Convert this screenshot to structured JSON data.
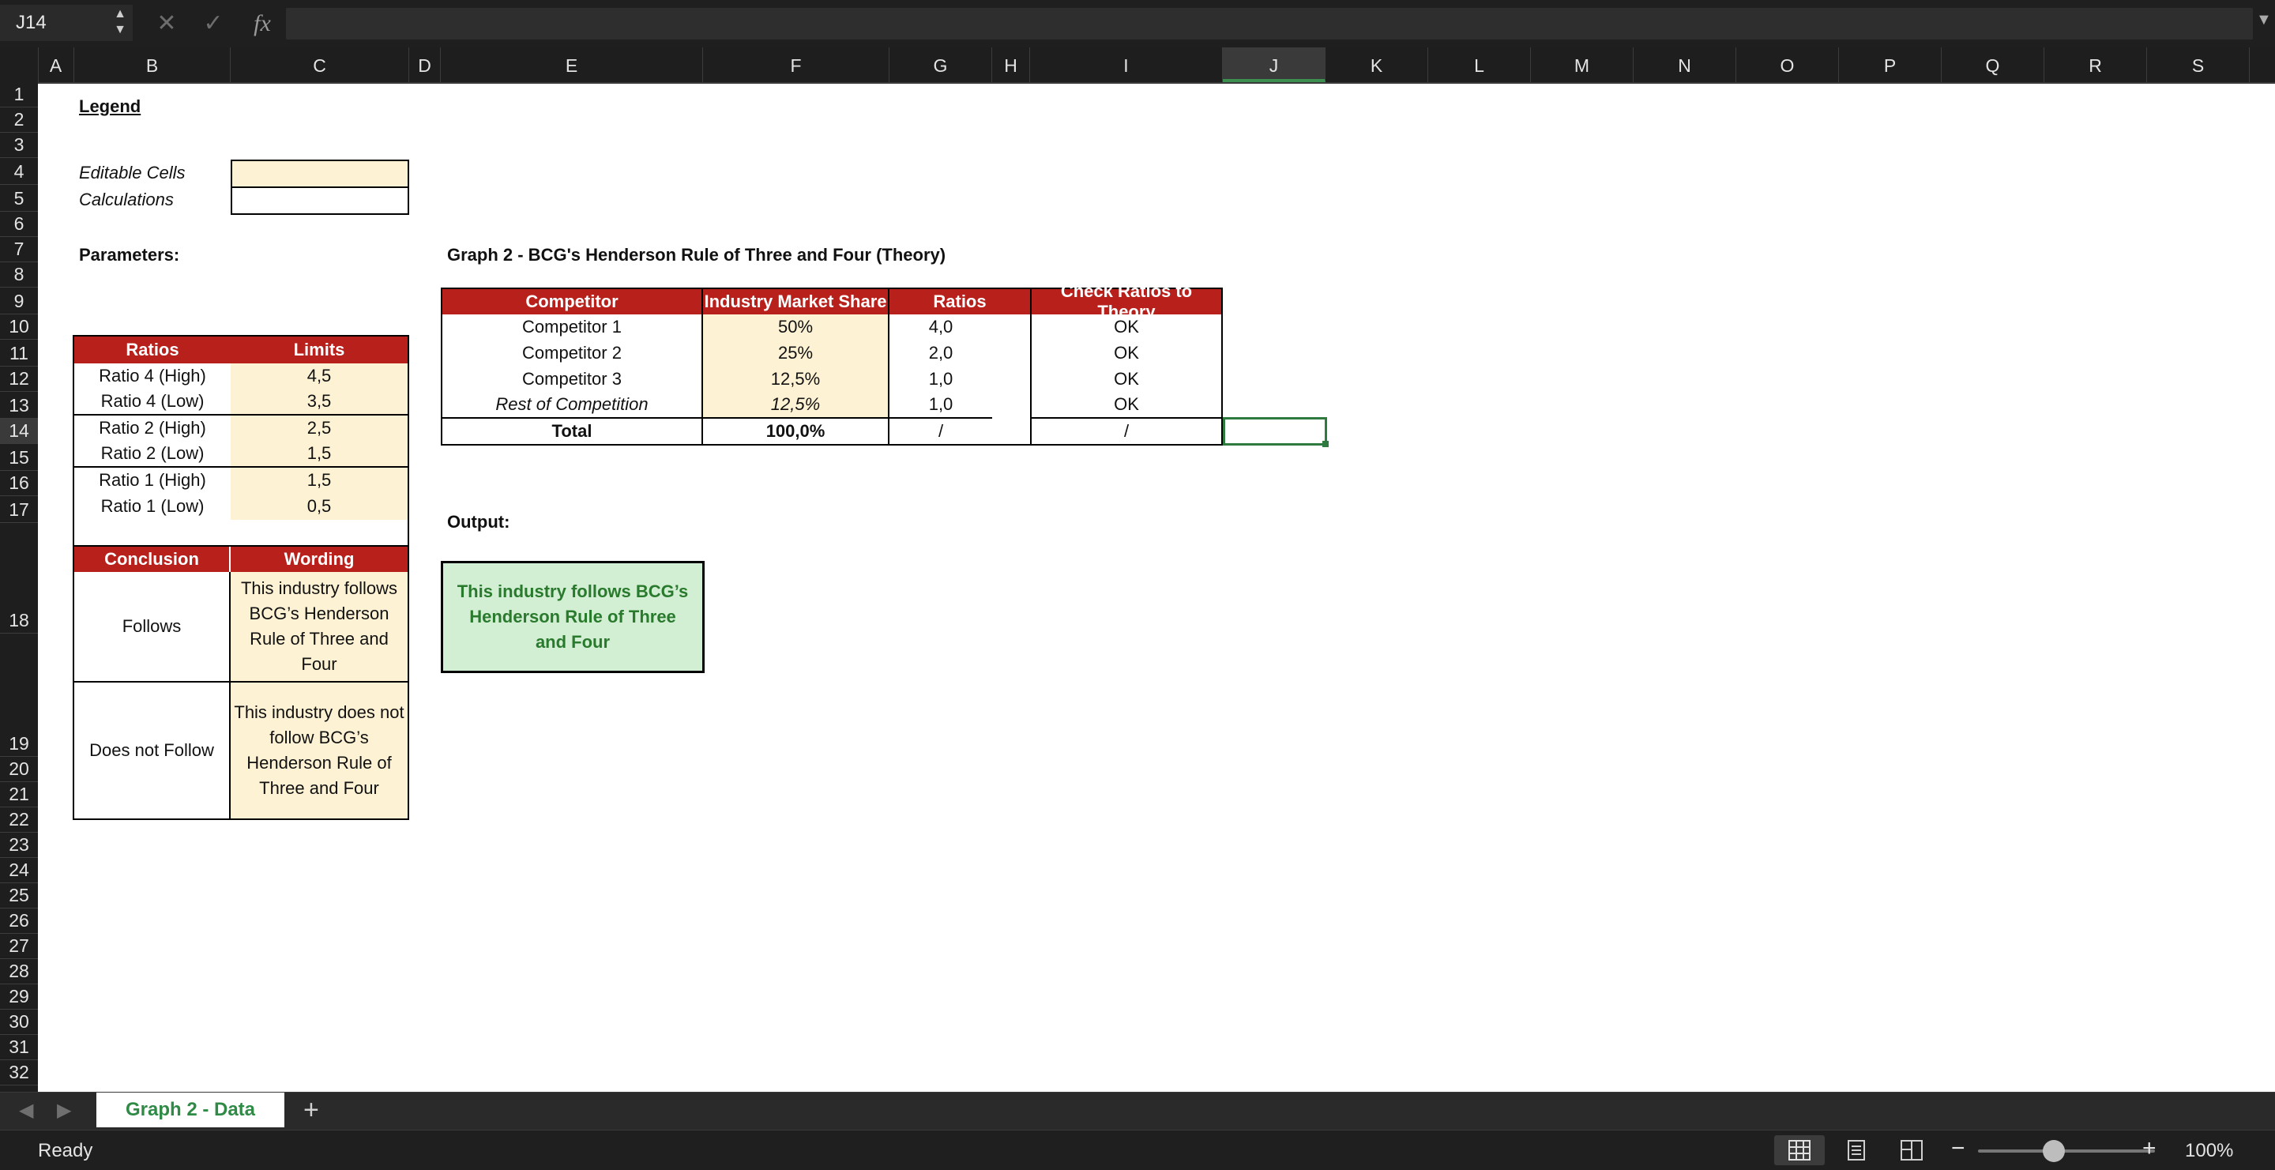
{
  "formula_bar": {
    "cell_ref": "J14",
    "formula": "",
    "cancel_icon": "cancel-icon",
    "confirm_icon": "confirm-icon",
    "fx_label": "fx"
  },
  "columns": [
    "A",
    "B",
    "C",
    "D",
    "E",
    "F",
    "G",
    "H",
    "I",
    "J",
    "K",
    "L",
    "M",
    "N",
    "O",
    "P",
    "Q",
    "R",
    "S"
  ],
  "rows": [
    "1",
    "2",
    "3",
    "4",
    "5",
    "6",
    "7",
    "8",
    "9",
    "10",
    "11",
    "12",
    "13",
    "14",
    "15",
    "16",
    "17",
    "18",
    "19",
    "20",
    "21",
    "22",
    "23",
    "24",
    "25",
    "26",
    "27",
    "28",
    "29",
    "30",
    "31",
    "32"
  ],
  "selected_cell": "J14",
  "legend": {
    "title": "Legend",
    "editable_label": "Editable Cells",
    "calculations_label": "Calculations"
  },
  "parameters": {
    "title": "Parameters:",
    "headers": [
      "Ratios",
      "Limits"
    ],
    "rows": [
      [
        "Ratio 4 (High)",
        "4,5"
      ],
      [
        "Ratio 4 (Low)",
        "3,5"
      ],
      [
        "Ratio 2 (High)",
        "2,5"
      ],
      [
        "Ratio 2 (Low)",
        "1,5"
      ],
      [
        "Ratio 1 (High)",
        "1,5"
      ],
      [
        "Ratio 1 (Low)",
        "0,5"
      ]
    ]
  },
  "conclusion": {
    "headers": [
      "Conclusion",
      "Wording"
    ],
    "rows": [
      [
        "Follows",
        "This industry follows BCG’s Henderson Rule of Three and Four"
      ],
      [
        "Does not Follow",
        "This industry does not follow BCG’s Henderson Rule of Three and Four"
      ]
    ]
  },
  "graph": {
    "title": "Graph 2 - BCG's Henderson Rule of Three and Four (Theory)",
    "headers": [
      "Competitor",
      "Industry Market Share",
      "Ratios"
    ],
    "rows": [
      [
        "Competitor 1",
        "50%",
        "4,0"
      ],
      [
        "Competitor 2",
        "25%",
        "2,0"
      ],
      [
        "Competitor 3",
        "12,5%",
        "1,0"
      ],
      [
        "Rest of Competition",
        "12,5%",
        "1,0"
      ]
    ],
    "total": [
      "Total",
      "100,0%",
      "/"
    ]
  },
  "check": {
    "header": "Check Ratios to Theory",
    "rows": [
      "OK",
      "OK",
      "OK",
      "OK"
    ],
    "total": "/"
  },
  "output": {
    "title": "Output:",
    "text": "This industry follows BCG’s Henderson Rule of Three and Four"
  },
  "sheet_tabs": {
    "active": "Graph 2 - Data",
    "add": "+"
  },
  "status": {
    "text": "Ready",
    "zoom": "100%"
  },
  "colors": {
    "header_red": "#b8201c",
    "editable": "#fdf2d4",
    "output_bg": "#d2efd3",
    "output_text": "#2a7a2e",
    "accent_green": "#2f8a46"
  }
}
